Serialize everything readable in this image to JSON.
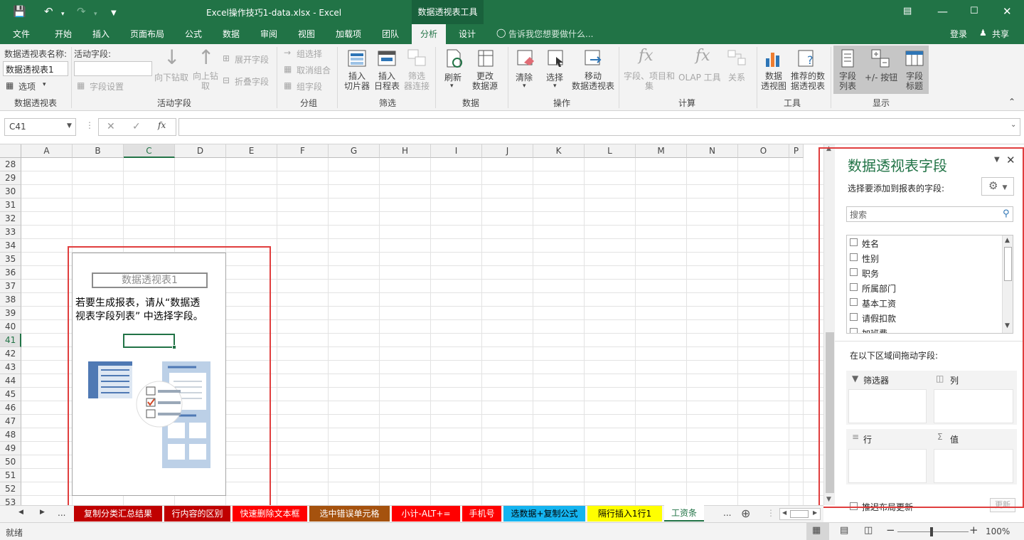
{
  "title": {
    "file": "Excel操作技巧1-data.xlsx - Excel",
    "context_tab": "数据透视表工具",
    "login": "登录",
    "share": "共享"
  },
  "tabs": [
    "文件",
    "开始",
    "插入",
    "页面布局",
    "公式",
    "数据",
    "审阅",
    "视图",
    "加载项",
    "团队",
    "分析",
    "设计"
  ],
  "tell_me": "告诉我您想要做什么...",
  "ribbon": {
    "pt_name_label": "数据透视表名称:",
    "pt_name_value": "数据透视表1",
    "options": "选项",
    "active_field_label": "活动字段:",
    "field_settings": "字段设置",
    "drill_down": "向下钻取",
    "drill_up_1": "向上钻",
    "drill_up_2": "取",
    "expand": "展开字段",
    "collapse": "折叠字段",
    "group_sel": "组选择",
    "ungroup": "取消组合",
    "group_field": "组字段",
    "slicer_1": "插入",
    "slicer_2": "切片器",
    "timeline_1": "插入",
    "timeline_2": "日程表",
    "filter_conn_1": "筛选",
    "filter_conn_2": "器连接",
    "refresh": "刷新",
    "change_src_1": "更改",
    "change_src_2": "数据源",
    "clear": "清除",
    "select": "选择",
    "move_1": "移动",
    "move_2": "数据透视表",
    "fields_items_1": "字段、项目和",
    "fields_items_2": "集",
    "olap": "OLAP 工具",
    "relations": "关系",
    "pivotchart_1": "数据",
    "pivotchart_2": "透视图",
    "recommended_1": "推荐的数",
    "recommended_2": "据透视表",
    "fieldlist_1": "字段",
    "fieldlist_2": "列表",
    "plusminus": "+/- 按钮",
    "headers_1": "字段",
    "headers_2": "标题",
    "groups": [
      "数据透视表",
      "活动字段",
      "分组",
      "筛选",
      "数据",
      "操作",
      "计算",
      "工具",
      "显示"
    ]
  },
  "formula": {
    "name_box": "C41",
    "fx": "fx",
    "value": ""
  },
  "columns": [
    "A",
    "B",
    "C",
    "D",
    "E",
    "F",
    "G",
    "H",
    "I",
    "J",
    "K",
    "L",
    "M",
    "N",
    "O",
    "P"
  ],
  "rows": [
    "28",
    "29",
    "30",
    "31",
    "32",
    "33",
    "34",
    "35",
    "36",
    "37",
    "38",
    "39",
    "40",
    "41",
    "42",
    "43",
    "44",
    "45",
    "46",
    "47",
    "48",
    "49",
    "50",
    "51",
    "52",
    "53"
  ],
  "placeholder": {
    "title": "数据透视表1",
    "message_1": "若要生成报表，请从“数据透",
    "message_2": "视表字段列表” 中选择字段。"
  },
  "pane": {
    "title": "数据透视表字段",
    "choose": "选择要添加到报表的字段:",
    "search_placeholder": "搜索",
    "fields": [
      "姓名",
      "性别",
      "职务",
      "所属部门",
      "基本工资",
      "请假扣款",
      "加班费"
    ],
    "drag_label": "在以下区域间拖动字段:",
    "filters": "筛选器",
    "columns": "列",
    "rows": "行",
    "values": "值",
    "defer": "推迟布局更新",
    "update": "更新"
  },
  "sheets": [
    {
      "name": "复制分类汇总结果",
      "bg": "#c00000",
      "fg": "#ffffff"
    },
    {
      "name": "行内容的区别",
      "bg": "#c00000",
      "fg": "#ffffff"
    },
    {
      "name": "快速删除文本框",
      "bg": "#ff0000",
      "fg": "#ffffff"
    },
    {
      "name": "选中错误单元格",
      "bg": "#a5520e",
      "fg": "#ffffff"
    },
    {
      "name": "小计-ALT+=",
      "bg": "#ff0000",
      "fg": "#ffffff"
    },
    {
      "name": "手机号",
      "bg": "#ff0000",
      "fg": "#ffffff"
    },
    {
      "name": "选数据+复制公式",
      "bg": "#14b4f0",
      "fg": "#000000"
    },
    {
      "name": "隔行插入1行1",
      "bg": "#ffff00",
      "fg": "#000000"
    },
    {
      "name": "工资条",
      "bg": "#ffffff",
      "fg": "#217346"
    }
  ],
  "sheet_ellipsis": "...",
  "status": {
    "ready": "就绪",
    "zoom": "100%"
  },
  "colors": {
    "accent": "#217346",
    "highlight": "#e03e3e"
  }
}
